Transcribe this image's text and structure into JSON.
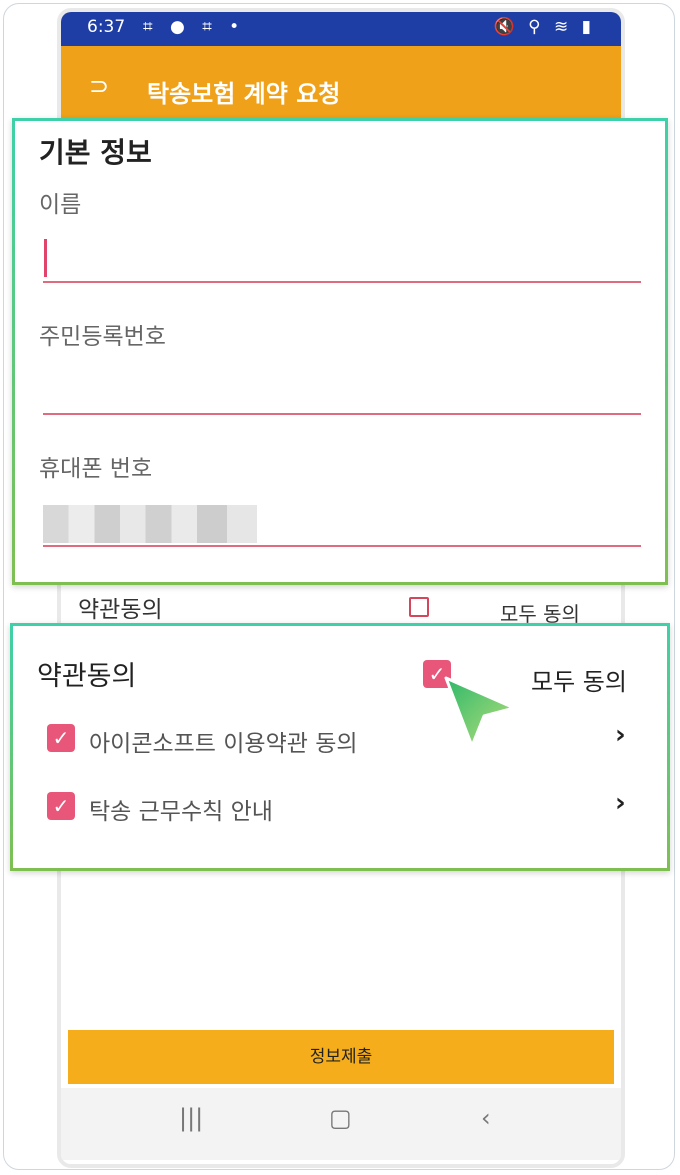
{
  "status_bar": {
    "time": "6:37",
    "left_icons": "⌗ ● ⌗ •",
    "right_icons": "🔇 ⚲ ≋ ▮"
  },
  "app_bar": {
    "back_icon": "back-arrow-icon",
    "title": "탁송보험 계약 요청"
  },
  "basic_info": {
    "title": "기본 정보",
    "name_label": "이름",
    "rrn_label": "주민등록번호",
    "phone_label": "휴대폰 번호"
  },
  "background_terms": {
    "title": "약관동의",
    "all_label": "모두 동의"
  },
  "terms": {
    "title": "약관동의",
    "all_label": "모두 동의",
    "items": [
      {
        "label": "아이콘소프트 이용약관 동의",
        "checked": true
      },
      {
        "label": "탁송 근무수칙 안내",
        "checked": true
      }
    ]
  },
  "submit_label": "정보제출",
  "colors": {
    "status_bar": "#1f3ea5",
    "app_bar": "#f0a11a",
    "accent_pink": "#e8577a",
    "submit_button": "#f5ad1c",
    "callout_border": "#3ed0a8"
  }
}
